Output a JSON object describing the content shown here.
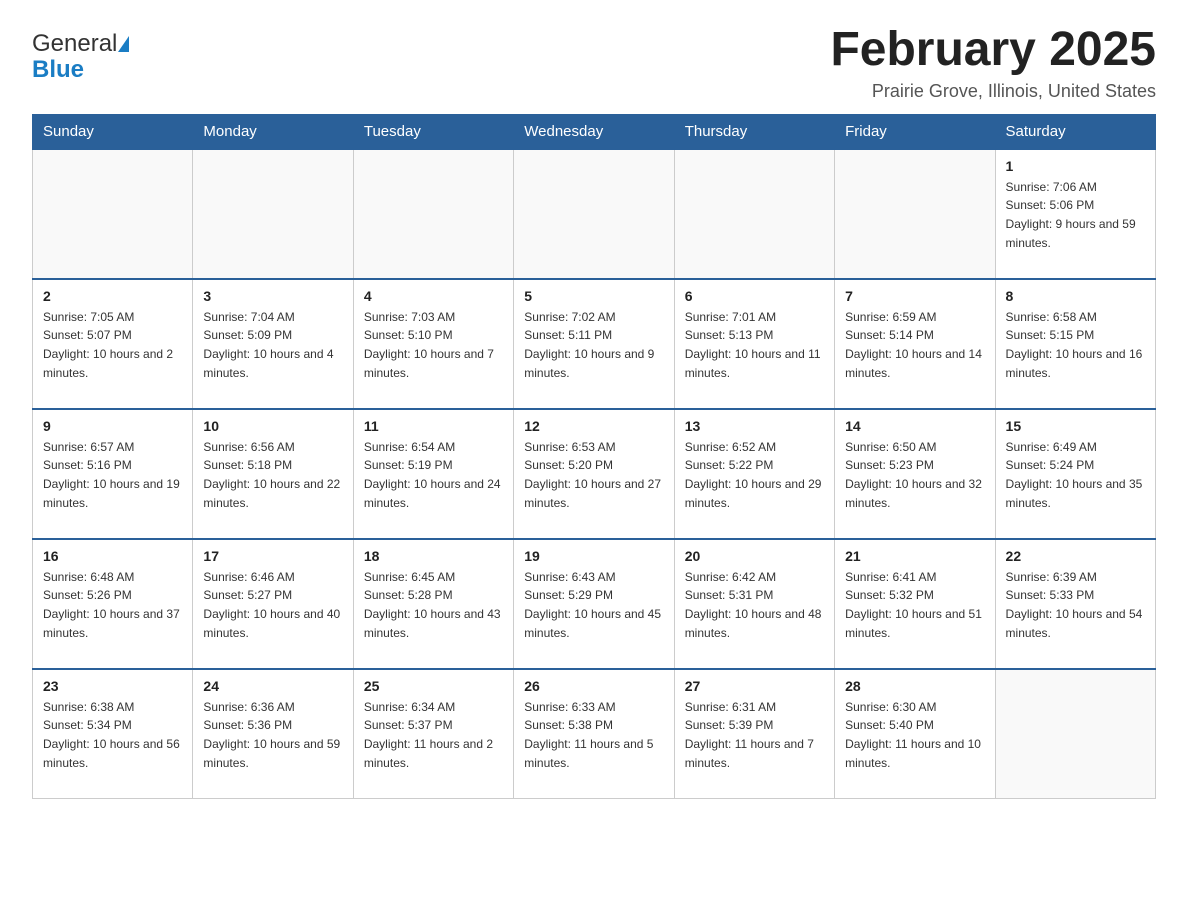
{
  "header": {
    "month_title": "February 2025",
    "location": "Prairie Grove, Illinois, United States",
    "logo_general": "General",
    "logo_blue": "Blue"
  },
  "weekdays": [
    "Sunday",
    "Monday",
    "Tuesday",
    "Wednesday",
    "Thursday",
    "Friday",
    "Saturday"
  ],
  "weeks": [
    [
      {
        "day": "",
        "sunrise": "",
        "sunset": "",
        "daylight": ""
      },
      {
        "day": "",
        "sunrise": "",
        "sunset": "",
        "daylight": ""
      },
      {
        "day": "",
        "sunrise": "",
        "sunset": "",
        "daylight": ""
      },
      {
        "day": "",
        "sunrise": "",
        "sunset": "",
        "daylight": ""
      },
      {
        "day": "",
        "sunrise": "",
        "sunset": "",
        "daylight": ""
      },
      {
        "day": "",
        "sunrise": "",
        "sunset": "",
        "daylight": ""
      },
      {
        "day": "1",
        "sunrise": "Sunrise: 7:06 AM",
        "sunset": "Sunset: 5:06 PM",
        "daylight": "Daylight: 9 hours and 59 minutes."
      }
    ],
    [
      {
        "day": "2",
        "sunrise": "Sunrise: 7:05 AM",
        "sunset": "Sunset: 5:07 PM",
        "daylight": "Daylight: 10 hours and 2 minutes."
      },
      {
        "day": "3",
        "sunrise": "Sunrise: 7:04 AM",
        "sunset": "Sunset: 5:09 PM",
        "daylight": "Daylight: 10 hours and 4 minutes."
      },
      {
        "day": "4",
        "sunrise": "Sunrise: 7:03 AM",
        "sunset": "Sunset: 5:10 PM",
        "daylight": "Daylight: 10 hours and 7 minutes."
      },
      {
        "day": "5",
        "sunrise": "Sunrise: 7:02 AM",
        "sunset": "Sunset: 5:11 PM",
        "daylight": "Daylight: 10 hours and 9 minutes."
      },
      {
        "day": "6",
        "sunrise": "Sunrise: 7:01 AM",
        "sunset": "Sunset: 5:13 PM",
        "daylight": "Daylight: 10 hours and 11 minutes."
      },
      {
        "day": "7",
        "sunrise": "Sunrise: 6:59 AM",
        "sunset": "Sunset: 5:14 PM",
        "daylight": "Daylight: 10 hours and 14 minutes."
      },
      {
        "day": "8",
        "sunrise": "Sunrise: 6:58 AM",
        "sunset": "Sunset: 5:15 PM",
        "daylight": "Daylight: 10 hours and 16 minutes."
      }
    ],
    [
      {
        "day": "9",
        "sunrise": "Sunrise: 6:57 AM",
        "sunset": "Sunset: 5:16 PM",
        "daylight": "Daylight: 10 hours and 19 minutes."
      },
      {
        "day": "10",
        "sunrise": "Sunrise: 6:56 AM",
        "sunset": "Sunset: 5:18 PM",
        "daylight": "Daylight: 10 hours and 22 minutes."
      },
      {
        "day": "11",
        "sunrise": "Sunrise: 6:54 AM",
        "sunset": "Sunset: 5:19 PM",
        "daylight": "Daylight: 10 hours and 24 minutes."
      },
      {
        "day": "12",
        "sunrise": "Sunrise: 6:53 AM",
        "sunset": "Sunset: 5:20 PM",
        "daylight": "Daylight: 10 hours and 27 minutes."
      },
      {
        "day": "13",
        "sunrise": "Sunrise: 6:52 AM",
        "sunset": "Sunset: 5:22 PM",
        "daylight": "Daylight: 10 hours and 29 minutes."
      },
      {
        "day": "14",
        "sunrise": "Sunrise: 6:50 AM",
        "sunset": "Sunset: 5:23 PM",
        "daylight": "Daylight: 10 hours and 32 minutes."
      },
      {
        "day": "15",
        "sunrise": "Sunrise: 6:49 AM",
        "sunset": "Sunset: 5:24 PM",
        "daylight": "Daylight: 10 hours and 35 minutes."
      }
    ],
    [
      {
        "day": "16",
        "sunrise": "Sunrise: 6:48 AM",
        "sunset": "Sunset: 5:26 PM",
        "daylight": "Daylight: 10 hours and 37 minutes."
      },
      {
        "day": "17",
        "sunrise": "Sunrise: 6:46 AM",
        "sunset": "Sunset: 5:27 PM",
        "daylight": "Daylight: 10 hours and 40 minutes."
      },
      {
        "day": "18",
        "sunrise": "Sunrise: 6:45 AM",
        "sunset": "Sunset: 5:28 PM",
        "daylight": "Daylight: 10 hours and 43 minutes."
      },
      {
        "day": "19",
        "sunrise": "Sunrise: 6:43 AM",
        "sunset": "Sunset: 5:29 PM",
        "daylight": "Daylight: 10 hours and 45 minutes."
      },
      {
        "day": "20",
        "sunrise": "Sunrise: 6:42 AM",
        "sunset": "Sunset: 5:31 PM",
        "daylight": "Daylight: 10 hours and 48 minutes."
      },
      {
        "day": "21",
        "sunrise": "Sunrise: 6:41 AM",
        "sunset": "Sunset: 5:32 PM",
        "daylight": "Daylight: 10 hours and 51 minutes."
      },
      {
        "day": "22",
        "sunrise": "Sunrise: 6:39 AM",
        "sunset": "Sunset: 5:33 PM",
        "daylight": "Daylight: 10 hours and 54 minutes."
      }
    ],
    [
      {
        "day": "23",
        "sunrise": "Sunrise: 6:38 AM",
        "sunset": "Sunset: 5:34 PM",
        "daylight": "Daylight: 10 hours and 56 minutes."
      },
      {
        "day": "24",
        "sunrise": "Sunrise: 6:36 AM",
        "sunset": "Sunset: 5:36 PM",
        "daylight": "Daylight: 10 hours and 59 minutes."
      },
      {
        "day": "25",
        "sunrise": "Sunrise: 6:34 AM",
        "sunset": "Sunset: 5:37 PM",
        "daylight": "Daylight: 11 hours and 2 minutes."
      },
      {
        "day": "26",
        "sunrise": "Sunrise: 6:33 AM",
        "sunset": "Sunset: 5:38 PM",
        "daylight": "Daylight: 11 hours and 5 minutes."
      },
      {
        "day": "27",
        "sunrise": "Sunrise: 6:31 AM",
        "sunset": "Sunset: 5:39 PM",
        "daylight": "Daylight: 11 hours and 7 minutes."
      },
      {
        "day": "28",
        "sunrise": "Sunrise: 6:30 AM",
        "sunset": "Sunset: 5:40 PM",
        "daylight": "Daylight: 11 hours and 10 minutes."
      },
      {
        "day": "",
        "sunrise": "",
        "sunset": "",
        "daylight": ""
      }
    ]
  ]
}
